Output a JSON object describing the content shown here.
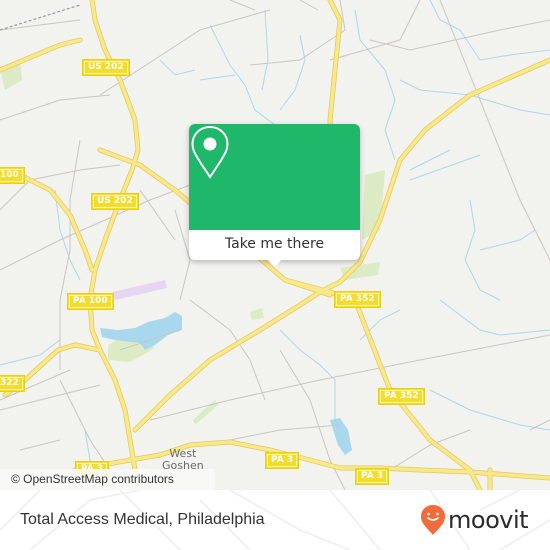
{
  "map": {
    "attribution": "© OpenStreetMap contributors",
    "colors": {
      "land": "#f2f2ef",
      "road_major": "#f5e37a",
      "road_minor": "#c9c6bf",
      "water": "#9fd3ec",
      "park": "#dcebc4",
      "shield": "#f4dc2c"
    },
    "road_shields": [
      {
        "label": "US 202"
      },
      {
        "label": "US 202"
      },
      {
        "label": "PA 100"
      },
      {
        "label": "100"
      },
      {
        "label": "322"
      },
      {
        "label": "PA 352"
      },
      {
        "label": "PA 352"
      },
      {
        "label": "PA 3"
      },
      {
        "label": "PA 3"
      },
      {
        "label": "PA 3"
      }
    ],
    "place_labels": [
      {
        "line1": "West",
        "line2": "Goshen"
      }
    ]
  },
  "popup": {
    "icon": "map-pin-icon",
    "button_label": "Take me there",
    "color": "#1fb86a"
  },
  "footer": {
    "title": "Total Access Medical, Philadelphia",
    "brand": "moovit",
    "brand_color": "#f26b3a"
  }
}
